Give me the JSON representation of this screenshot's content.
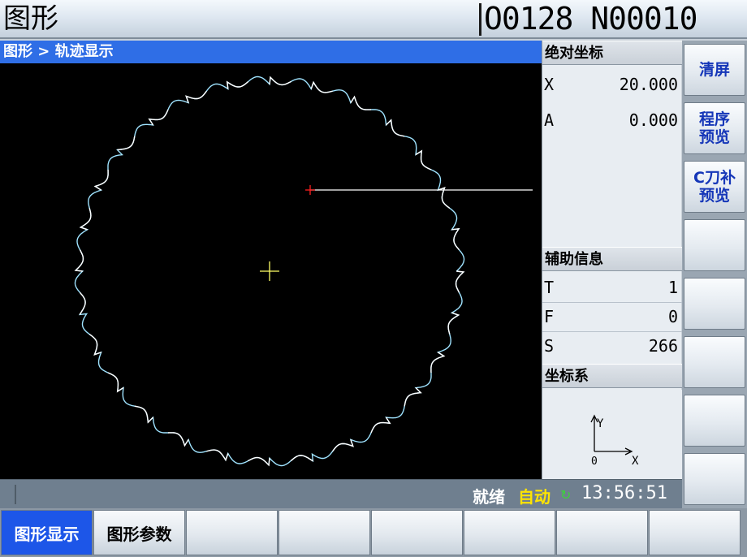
{
  "header": {
    "screen_title": "图形",
    "program_number": "O0128 N00010"
  },
  "breadcrumb": "图形 > 轨迹显示",
  "viewport": {
    "tool_marker_color": "#ff2020",
    "origin_marker_color": "#ffff66",
    "path_colors": [
      "#9fe3ff",
      "#ffffff"
    ],
    "teeth_count": 28
  },
  "absolute_coords": {
    "title": "绝对坐标",
    "axes": [
      {
        "label": "X",
        "value": "20.000"
      },
      {
        "label": "A",
        "value": "0.000"
      }
    ]
  },
  "aux_info": {
    "title": "辅助信息",
    "items": [
      {
        "label": "T",
        "value": "1"
      },
      {
        "label": "F",
        "value": "0"
      },
      {
        "label": "S",
        "value": "266"
      }
    ]
  },
  "coord_system": {
    "title": "坐标系",
    "axis_y": "Y",
    "axis_x": "X",
    "origin": "0"
  },
  "status": {
    "ready": "就绪",
    "mode": "自动",
    "time": "13:56:51"
  },
  "softkeys_right": [
    {
      "label": "清屏"
    },
    {
      "label": "程序\n预览"
    },
    {
      "label": "C刀补\n预览"
    },
    {
      "label": ""
    },
    {
      "label": ""
    },
    {
      "label": ""
    },
    {
      "label": ""
    },
    {
      "label": ""
    }
  ],
  "softkeys_bottom": [
    {
      "label": "图形显示",
      "active": true
    },
    {
      "label": "图形参数",
      "active": false
    },
    {
      "label": "",
      "active": false
    },
    {
      "label": "",
      "active": false
    },
    {
      "label": "",
      "active": false
    },
    {
      "label": "",
      "active": false
    },
    {
      "label": "",
      "active": false
    },
    {
      "label": "",
      "active": false
    }
  ]
}
